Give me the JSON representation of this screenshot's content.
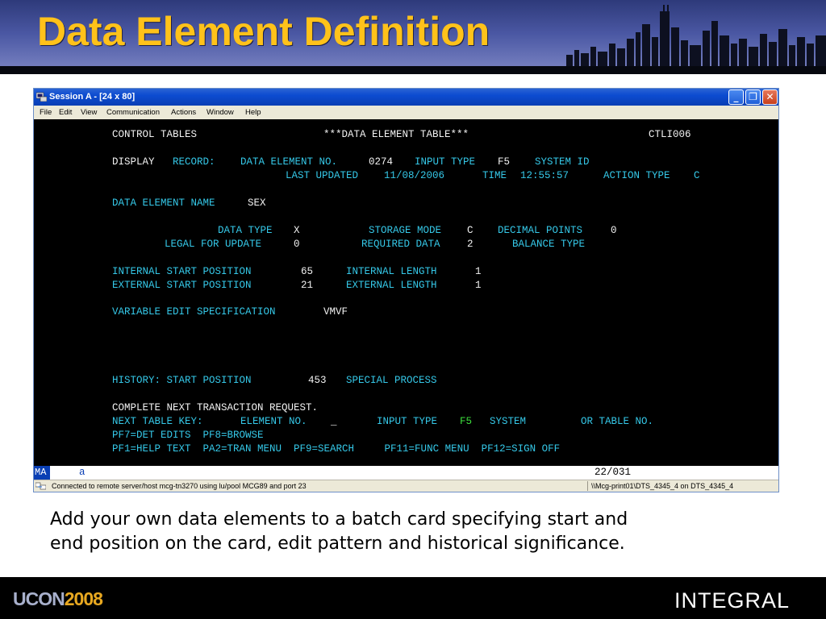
{
  "slide": {
    "title": "Data Element Definition",
    "caption_line1": "Add your own data elements to a batch card specifying start and",
    "caption_line2": "end position on the card, edit pattern and historical significance.",
    "footer_left_a": "UCON",
    "footer_left_b": "2008",
    "footer_right": "INTEGRAL"
  },
  "window": {
    "title": "Session A - [24 x 80]",
    "controls": {
      "minimize": "_",
      "maximize": "❐",
      "close": "✕"
    },
    "menu": [
      "File",
      "Edit",
      "View",
      "Communication",
      "Actions",
      "Window",
      "Help"
    ]
  },
  "terminal": {
    "r1": {
      "a": "CONTROL TABLES",
      "b": "***DATA ELEMENT TABLE***",
      "c": "CTLI006"
    },
    "r2": {
      "display": "DISPLAY",
      "record": "RECORD:",
      "den_label": "DATA ELEMENT NO.",
      "den_value": "0274",
      "input_label": "INPUT TYPE",
      "input_value": "F5",
      "system_label": "SYSTEM ID"
    },
    "r3": {
      "last_label": "LAST UPDATED",
      "last_value": "11/08/2006",
      "time_label": "TIME",
      "time_value": "12:55:57",
      "action_label": "ACTION TYPE",
      "action_value": "C"
    },
    "r4": {
      "label": "DATA ELEMENT NAME",
      "value": "SEX"
    },
    "r5": {
      "dt_label": "DATA TYPE",
      "dt_value": "X",
      "sm_label": "STORAGE MODE",
      "sm_value": "C",
      "dp_label": "DECIMAL POINTS",
      "dp_value": "0"
    },
    "r6": {
      "lf_label": "LEGAL FOR UPDATE",
      "lf_value": "0",
      "rd_label": "REQUIRED DATA",
      "rd_value": "2",
      "bt_label": "BALANCE TYPE"
    },
    "r7": {
      "isp_label": "INTERNAL START POSITION",
      "isp_value": "65",
      "il_label": "INTERNAL LENGTH",
      "il_value": "1"
    },
    "r8": {
      "esp_label": "EXTERNAL START POSITION",
      "esp_value": "21",
      "el_label": "EXTERNAL LENGTH",
      "el_value": "1"
    },
    "r9": {
      "label": "VARIABLE EDIT SPECIFICATION",
      "value": "VMVF"
    },
    "r10": {
      "label": "HISTORY: START POSITION",
      "value": "453",
      "sp_label": "SPECIAL PROCESS"
    },
    "r11": {
      "text": "COMPLETE NEXT TRANSACTION REQUEST."
    },
    "r12": {
      "ntk": "NEXT TABLE KEY:",
      "en_label": "ELEMENT NO.",
      "cursor": "_",
      "it_label": "INPUT TYPE",
      "it_value": "F5",
      "sys_label": "SYSTEM",
      "ort_label": "OR TABLE NO."
    },
    "r13": {
      "text": "PF7=DET EDITS  PF8=BROWSE"
    },
    "r14": {
      "text": "PF1=HELP TEXT  PA2=TRAN MENU  PF9=SEARCH     PF11=FUNC MENU  PF12=SIGN OFF"
    }
  },
  "oia": {
    "ma": "MA",
    "a": "a",
    "pos": "22/031"
  },
  "status": {
    "left": "Connected to remote server/host mcg-tn3270 using lu/pool MCG89    and port 23",
    "right": "\\\\Mcg-print01\\DTS_4345_4 on DTS_4345_4"
  }
}
